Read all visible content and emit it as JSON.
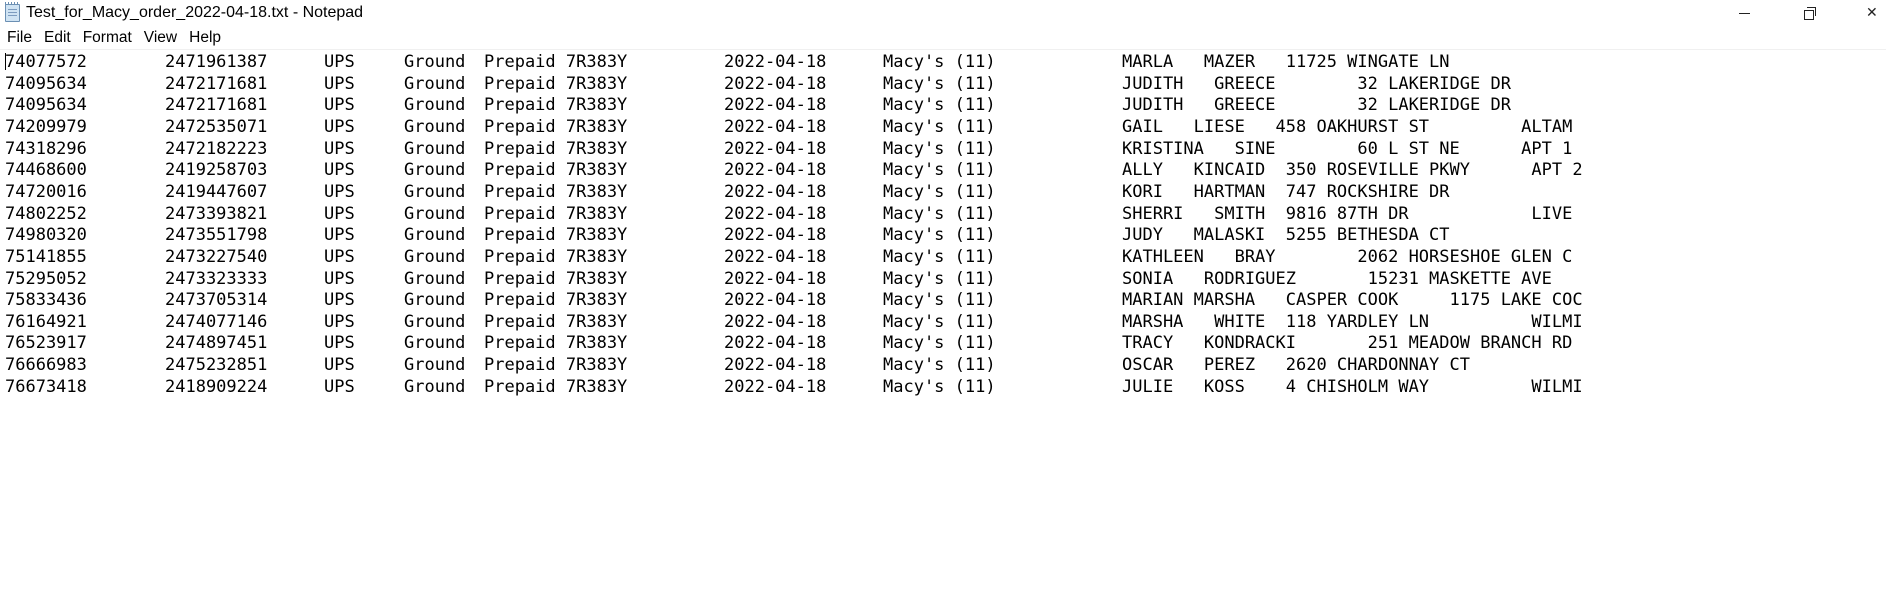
{
  "window": {
    "title": "Test_for_Macy_order_2022-04-18.txt - Notepad",
    "minimize_icon": "minimize-icon",
    "maximize_icon": "restore-icon",
    "close_glyph": "✕"
  },
  "menu": [
    "File",
    "Edit",
    "Format",
    "View",
    "Help"
  ],
  "lines": [
    [
      "74077572",
      "2471961387",
      "UPS",
      "Ground",
      "Prepaid 7R383Y",
      "2022-04-18",
      "Macy's (11)",
      "MARLA   MAZER   11725 WINGATE LN"
    ],
    [
      "74095634",
      "2472171681",
      "UPS",
      "Ground",
      "Prepaid 7R383Y",
      "2022-04-18",
      "Macy's (11)",
      "JUDITH   GREECE        32 LAKERIDGE DR"
    ],
    [
      "74095634",
      "2472171681",
      "UPS",
      "Ground",
      "Prepaid 7R383Y",
      "2022-04-18",
      "Macy's (11)",
      "JUDITH   GREECE        32 LAKERIDGE DR"
    ],
    [
      "74209979",
      "2472535071",
      "UPS",
      "Ground",
      "Prepaid 7R383Y",
      "2022-04-18",
      "Macy's (11)",
      "GAIL   LIESE   458 OAKHURST ST         ALTAM"
    ],
    [
      "74318296",
      "2472182223",
      "UPS",
      "Ground",
      "Prepaid 7R383Y",
      "2022-04-18",
      "Macy's (11)",
      "KRISTINA   SINE        60 L ST NE      APT 1"
    ],
    [
      "74468600",
      "2419258703",
      "UPS",
      "Ground",
      "Prepaid 7R383Y",
      "2022-04-18",
      "Macy's (11)",
      "ALLY   KINCAID  350 ROSEVILLE PKWY      APT 2"
    ],
    [
      "74720016",
      "2419447607",
      "UPS",
      "Ground",
      "Prepaid 7R383Y",
      "2022-04-18",
      "Macy's (11)",
      "KORI   HARTMAN  747 ROCKSHIRE DR"
    ],
    [
      "74802252",
      "2473393821",
      "UPS",
      "Ground",
      "Prepaid 7R383Y",
      "2022-04-18",
      "Macy's (11)",
      "SHERRI   SMITH  9816 87TH DR            LIVE"
    ],
    [
      "74980320",
      "2473551798",
      "UPS",
      "Ground",
      "Prepaid 7R383Y",
      "2022-04-18",
      "Macy's (11)",
      "JUDY   MALASKI  5255 BETHESDA CT"
    ],
    [
      "75141855",
      "2473227540",
      "UPS",
      "Ground",
      "Prepaid 7R383Y",
      "2022-04-18",
      "Macy's (11)",
      "KATHLEEN   BRAY        2062 HORSESHOE GLEN C"
    ],
    [
      "75295052",
      "2473323333",
      "UPS",
      "Ground",
      "Prepaid 7R383Y",
      "2022-04-18",
      "Macy's (11)",
      "SONIA   RODRIGUEZ       15231 MASKETTE AVE"
    ],
    [
      "75833436",
      "2473705314",
      "UPS",
      "Ground",
      "Prepaid 7R383Y",
      "2022-04-18",
      "Macy's (11)",
      "MARIAN MARSHA   CASPER COOK     1175 LAKE COC"
    ],
    [
      "76164921",
      "2474077146",
      "UPS",
      "Ground",
      "Prepaid 7R383Y",
      "2022-04-18",
      "Macy's (11)",
      "MARSHA   WHITE  118 YARDLEY LN          WILMI"
    ],
    [
      "76523917",
      "2474897451",
      "UPS",
      "Ground",
      "Prepaid 7R383Y",
      "2022-04-18",
      "Macy's (11)",
      "TRACY   KONDRACKI       251 MEADOW BRANCH RD"
    ],
    [
      "76666983",
      "2475232851",
      "UPS",
      "Ground",
      "Prepaid 7R383Y",
      "2022-04-18",
      "Macy's (11)",
      "OSCAR   PEREZ   2620 CHARDONNAY CT"
    ],
    [
      "76673418",
      "2418909224",
      "UPS",
      "Ground",
      "Prepaid 7R383Y",
      "2022-04-18",
      "Macy's (11)",
      "JULIE   KOSS    4 CHISHOLM WAY          WILMI"
    ]
  ]
}
